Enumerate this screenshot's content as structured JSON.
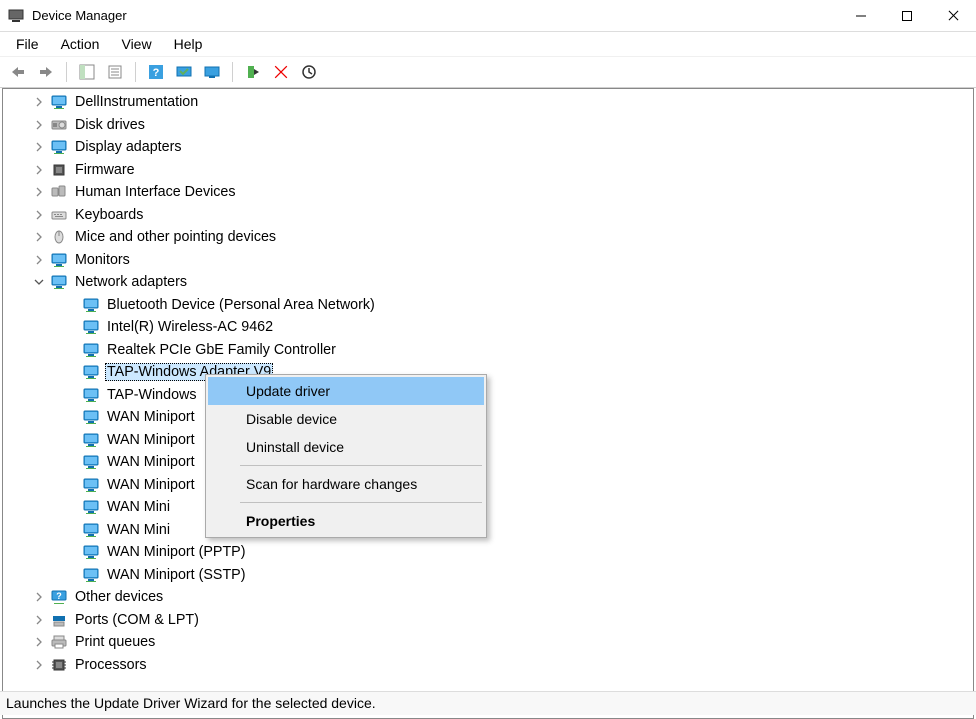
{
  "window": {
    "title": "Device Manager"
  },
  "menu": {
    "file": "File",
    "action": "Action",
    "view": "View",
    "help": "Help"
  },
  "categories": [
    {
      "label": "DellInstrumentation",
      "icon": "monitor",
      "expanded": false
    },
    {
      "label": "Disk drives",
      "icon": "disk",
      "expanded": false
    },
    {
      "label": "Display adapters",
      "icon": "display",
      "expanded": false
    },
    {
      "label": "Firmware",
      "icon": "firmware",
      "expanded": false
    },
    {
      "label": "Human Interface Devices",
      "icon": "hid",
      "expanded": false
    },
    {
      "label": "Keyboards",
      "icon": "keyboard",
      "expanded": false
    },
    {
      "label": "Mice and other pointing devices",
      "icon": "mouse",
      "expanded": false
    },
    {
      "label": "Monitors",
      "icon": "monitor",
      "expanded": false
    },
    {
      "label": "Network adapters",
      "icon": "network",
      "expanded": true,
      "children": [
        {
          "label": "Bluetooth Device (Personal Area Network)"
        },
        {
          "label": "Intel(R) Wireless-AC 9462"
        },
        {
          "label": "Realtek PCIe GbE Family Controller"
        },
        {
          "label": "TAP-Windows Adapter V9",
          "selected": true
        },
        {
          "label": "TAP-Windows"
        },
        {
          "label": "WAN Miniport"
        },
        {
          "label": "WAN Miniport"
        },
        {
          "label": "WAN Miniport"
        },
        {
          "label": "WAN Miniport"
        },
        {
          "label": "WAN Mini"
        },
        {
          "label": "WAN Mini"
        },
        {
          "label": "WAN Miniport (PPTP)"
        },
        {
          "label": "WAN Miniport (SSTP)"
        }
      ]
    },
    {
      "label": "Other devices",
      "icon": "other",
      "expanded": false
    },
    {
      "label": "Ports (COM & LPT)",
      "icon": "ports",
      "expanded": false
    },
    {
      "label": "Print queues",
      "icon": "printer",
      "expanded": false
    },
    {
      "label": "Processors",
      "icon": "processor",
      "expanded": false
    }
  ],
  "context_menu": {
    "items": [
      {
        "label": "Update driver",
        "highlight": true
      },
      {
        "label": "Disable device"
      },
      {
        "label": "Uninstall device"
      },
      {
        "sep": true
      },
      {
        "label": "Scan for hardware changes"
      },
      {
        "sep": true
      },
      {
        "label": "Properties",
        "bold": true
      }
    ]
  },
  "status": "Launches the Update Driver Wizard for the selected device."
}
